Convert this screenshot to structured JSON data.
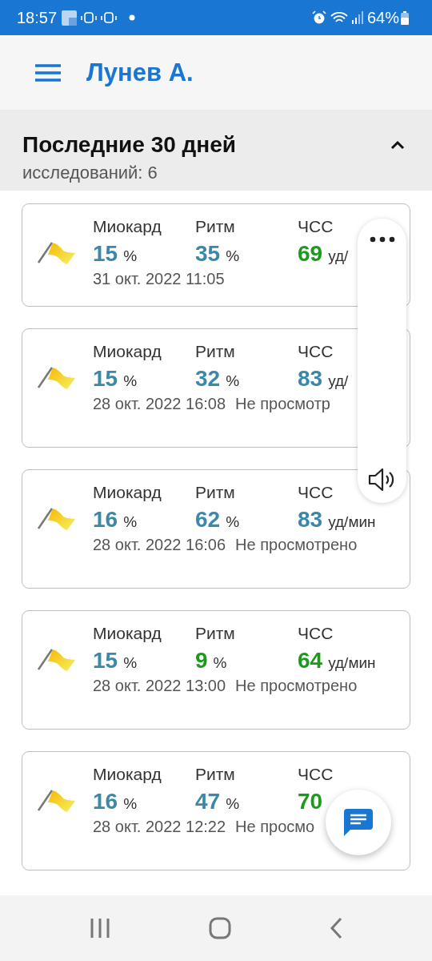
{
  "status_bar": {
    "time": "18:57",
    "battery": "64%"
  },
  "app_bar": {
    "title": "Лунев А."
  },
  "section": {
    "title": "Последние 30 дней",
    "subtitle": "исследований: 6",
    "expanded": true
  },
  "cards": [
    {
      "metrics": [
        {
          "label": "Миокард",
          "value": "15",
          "unit": "%",
          "color": "#3a88aa"
        },
        {
          "label": "Ритм",
          "value": "35",
          "unit": "%",
          "color": "#3a88aa"
        },
        {
          "label": "ЧСС",
          "value": "69",
          "unit": "уд/",
          "color": "#1c9a1c"
        }
      ],
      "date": "31 окт. 2022 11:05"
    },
    {
      "metrics": [
        {
          "label": "Миокард",
          "value": "15",
          "unit": "%",
          "color": "#3a88aa"
        },
        {
          "label": "Ритм",
          "value": "32",
          "unit": "%",
          "color": "#3a88aa"
        },
        {
          "label": "ЧСС",
          "value": "83",
          "unit": "уд/",
          "color": "#3a88aa"
        }
      ],
      "date": "28 окт. 2022 16:08",
      "status": "Не просмотр"
    },
    {
      "metrics": [
        {
          "label": "Миокард",
          "value": "16",
          "unit": "%",
          "color": "#3a88aa"
        },
        {
          "label": "Ритм",
          "value": "62",
          "unit": "%",
          "color": "#3a88aa"
        },
        {
          "label": "ЧСС",
          "value": "83",
          "unit": "уд/мин",
          "color": "#3a88aa"
        }
      ],
      "date": "28 окт. 2022 16:06",
      "status": "Не просмотрено"
    },
    {
      "metrics": [
        {
          "label": "Миокард",
          "value": "15",
          "unit": "%",
          "color": "#3a88aa"
        },
        {
          "label": "Ритм",
          "value": "9",
          "unit": "%",
          "color": "#1c9a1c"
        },
        {
          "label": "ЧСС",
          "value": "64",
          "unit": "уд/мин",
          "color": "#1c9a1c"
        }
      ],
      "date": "28 окт. 2022 13:00",
      "status": "Не просмотрено"
    },
    {
      "metrics": [
        {
          "label": "Миокард",
          "value": "16",
          "unit": "%",
          "color": "#3a88aa"
        },
        {
          "label": "Ритм",
          "value": "47",
          "unit": "%",
          "color": "#3a88aa"
        },
        {
          "label": "ЧСС",
          "value": "70",
          "color": "#1c9a1c"
        }
      ],
      "date": "28 окт. 2022 12:22",
      "status": "Не просмо"
    }
  ]
}
